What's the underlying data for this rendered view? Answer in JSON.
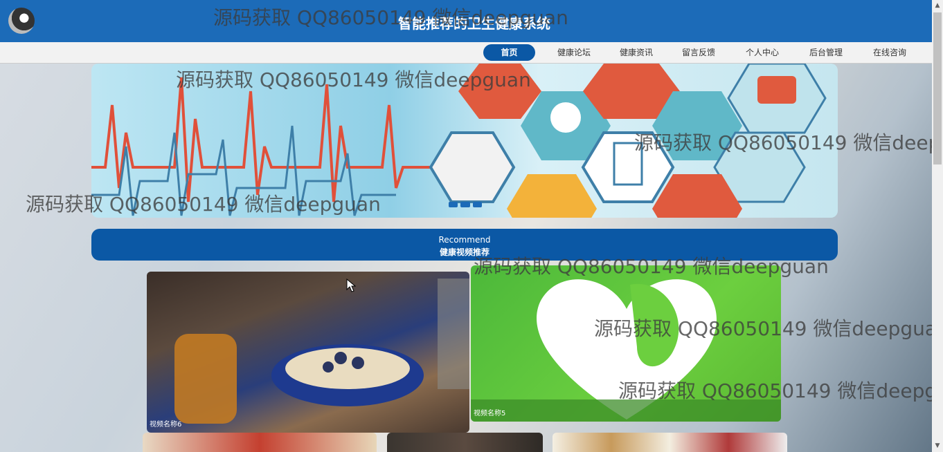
{
  "header": {
    "title": "智能推荐的卫生健康系统"
  },
  "nav": {
    "items": [
      {
        "label": "首页"
      },
      {
        "label": "健康论坛"
      },
      {
        "label": "健康资讯"
      },
      {
        "label": "留言反馈"
      },
      {
        "label": "个人中心"
      },
      {
        "label": "后台管理"
      },
      {
        "label": "在线咨询"
      }
    ]
  },
  "recommend": {
    "en": "Recommend",
    "cn": "健康视频推荐"
  },
  "videos": [
    {
      "name": "视频名称6"
    },
    {
      "name": "视频名称5"
    }
  ],
  "watermark": "源码获取 QQ86050149 微信deepguan",
  "colors": {
    "primary": "#1c6bb8",
    "active": "#0b58a5"
  }
}
